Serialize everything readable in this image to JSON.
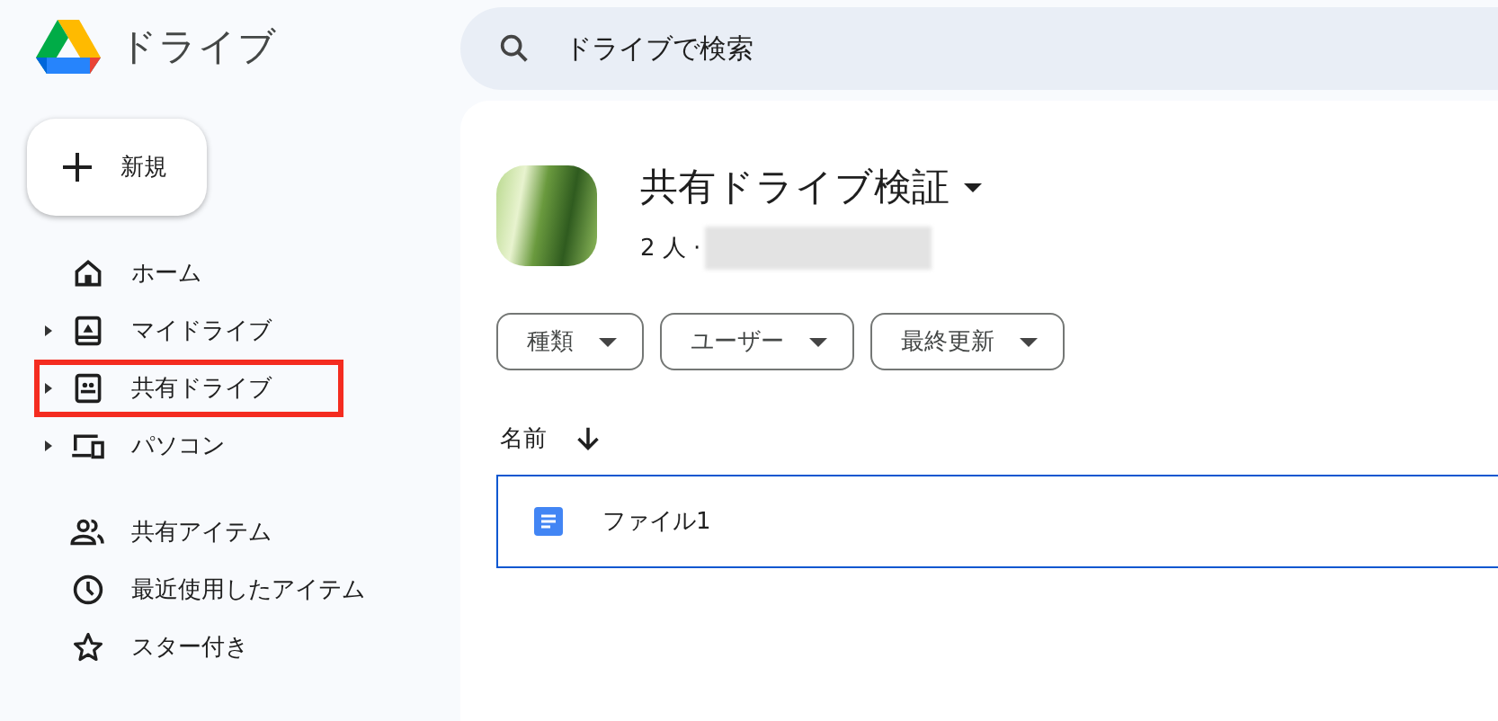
{
  "app": {
    "title": "ドライブ"
  },
  "search": {
    "placeholder": "ドライブで検索"
  },
  "new_button": {
    "label": "新規"
  },
  "sidebar": {
    "groups": [
      {
        "items": [
          {
            "kind": "home",
            "label": "ホーム",
            "expandable": false,
            "highlighted": false
          },
          {
            "kind": "my-drive",
            "label": "マイドライブ",
            "expandable": true,
            "highlighted": false
          },
          {
            "kind": "shared-drive",
            "label": "共有ドライブ",
            "expandable": true,
            "highlighted": true
          },
          {
            "kind": "computers",
            "label": "パソコン",
            "expandable": true,
            "highlighted": false
          }
        ]
      },
      {
        "items": [
          {
            "kind": "shared",
            "label": "共有アイテム",
            "expandable": false,
            "highlighted": false
          },
          {
            "kind": "recent",
            "label": "最近使用したアイテム",
            "expandable": false,
            "highlighted": false
          },
          {
            "kind": "starred",
            "label": "スター付き",
            "expandable": false,
            "highlighted": false
          }
        ]
      }
    ]
  },
  "drive": {
    "title": "共有ドライブ検証",
    "members": "2 人 ·"
  },
  "filters": [
    {
      "label": "種類"
    },
    {
      "label": "ユーザー"
    },
    {
      "label": "最終更新"
    }
  ],
  "table": {
    "columns": [
      {
        "label": "名前",
        "sorted": true
      }
    ],
    "rows": [
      {
        "name": "ファイル1",
        "selected": true
      }
    ]
  }
}
